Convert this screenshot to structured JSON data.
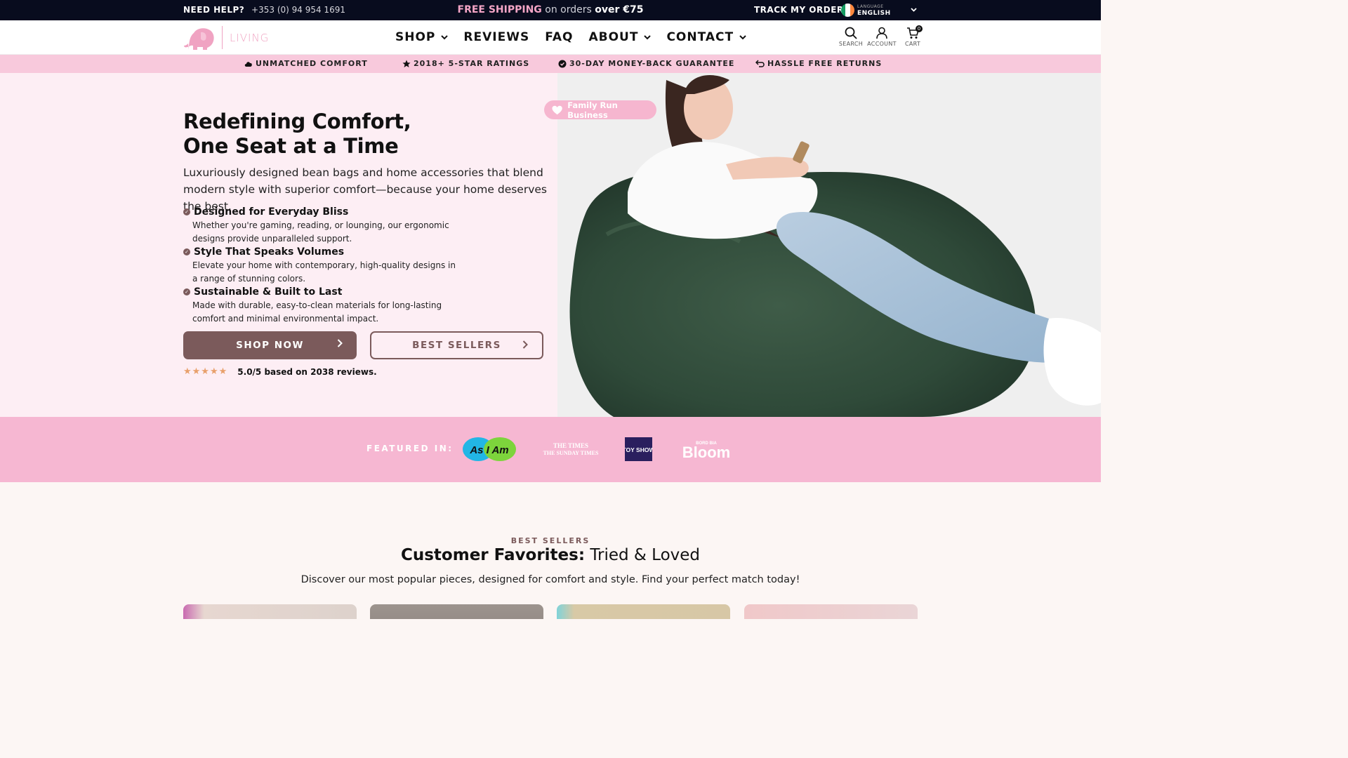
{
  "topbar": {
    "help_label": "NEED HELP?",
    "phone": "+353 (0) 94 954 1691",
    "shipping_highlight": "FREE SHIPPING",
    "shipping_middle": " on orders ",
    "shipping_over": "over ",
    "shipping_amount": "€75",
    "track_order": "TRACK MY ORDER",
    "language_label": "LANGUAGE",
    "language_value": "ENGLISH"
  },
  "header": {
    "logo_text": "LIVING",
    "nav": [
      {
        "label": "SHOP",
        "dropdown": true
      },
      {
        "label": "REVIEWS",
        "dropdown": false
      },
      {
        "label": "FAQ",
        "dropdown": false
      },
      {
        "label": "ABOUT",
        "dropdown": true
      },
      {
        "label": "CONTACT",
        "dropdown": true
      }
    ],
    "search_label": "SEARCH",
    "account_label": "ACCOUNT",
    "cart_label": "CART",
    "cart_count": "0"
  },
  "usp": [
    {
      "label": "UNMATCHED COMFORT",
      "icon": "cloud-icon"
    },
    {
      "label": "2018+ 5-STAR RATINGS",
      "icon": "star-icon"
    },
    {
      "label": "30-DAY MONEY-BACK GUARANTEE",
      "icon": "badge-check-icon"
    },
    {
      "label": "HASSLE FREE RETURNS",
      "icon": "return-icon"
    }
  ],
  "hero": {
    "badge": "Family Run Business",
    "title_line1": "Redefining Comfort,",
    "title_line2": "One Seat at a Time",
    "lede": "Luxuriously designed bean bags and home accessories that blend modern style with superior comfort—because your home deserves the best.",
    "features": [
      {
        "title": "Designed for Everyday Bliss",
        "desc": "Whether you're gaming, reading, or lounging, our ergonomic designs provide unparalleled support."
      },
      {
        "title": "Style That Speaks Volumes",
        "desc": "Elevate your home with contemporary, high-quality designs in a range of stunning colors."
      },
      {
        "title": "Sustainable & Built to Last",
        "desc": "Made with durable, easy-to-clean materials for long-lasting comfort and minimal environmental impact."
      }
    ],
    "primary_button": "SHOP NOW",
    "secondary_button": "BEST SELLERS",
    "stars": "★★★★★",
    "rating_text": "5.0/5 based on 2038 reviews."
  },
  "featured": {
    "label": "FEATURED IN:",
    "publications": [
      "As I Am",
      "THE TIMES",
      "THE SUNDAY TIMES",
      "TOY SHOW",
      "BORD BIA",
      "Bloom"
    ]
  },
  "bestsellers": {
    "eyebrow": "BEST SELLERS",
    "title_bold": "Customer Favorites:",
    "title_regular": " Tried & Loved",
    "subtitle": "Discover our most popular pieces, designed for comfort and style. Find your perfect match today!"
  },
  "colors": {
    "topbar_bg": "#080c1e",
    "accent_pink": "#f6b7d2",
    "usp_pink": "#f8c9dc",
    "hero_bg": "#fdeef4",
    "brand_brown": "#7b5a5b",
    "star_orange": "#e8a06b"
  }
}
